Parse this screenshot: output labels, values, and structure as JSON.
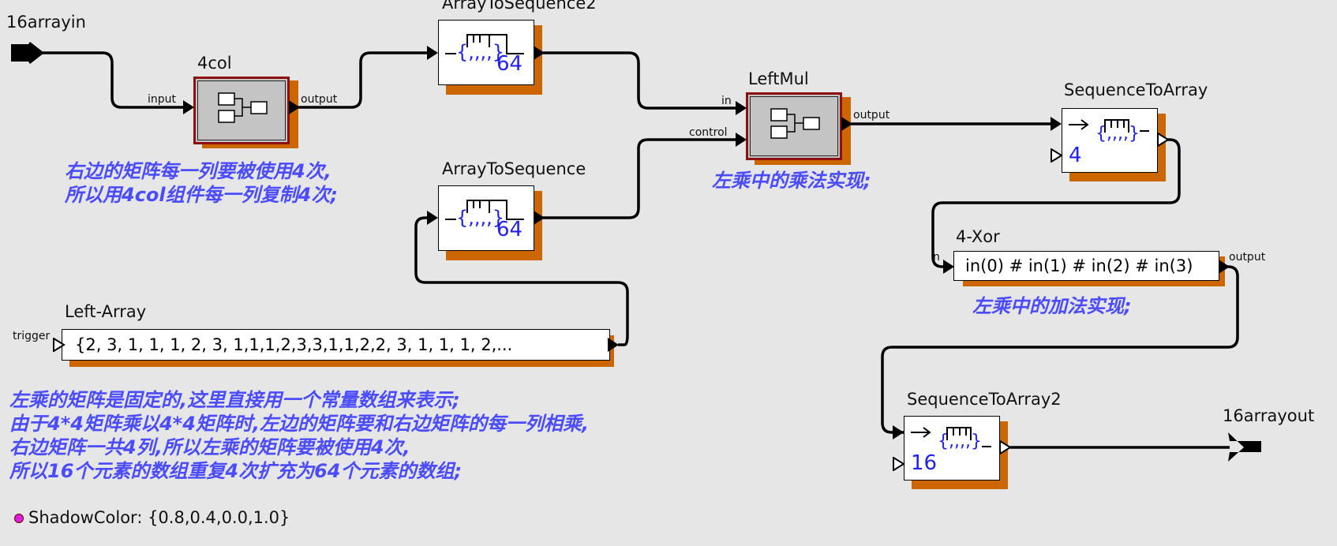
{
  "actors": {
    "input_port": "16arrayin",
    "output_port": "16arrayout",
    "col4": "4col",
    "ats2": "ArrayToSequence2",
    "ats": "ArrayToSequence",
    "leftmul": "LeftMul",
    "sta": "SequenceToArray",
    "xor": "4-Xor",
    "sta2": "SequenceToArray2",
    "left_array": "Left-Array"
  },
  "ports": {
    "input": "input",
    "output": "output",
    "in": "in",
    "control": "control",
    "trigger": "trigger",
    "n": "n"
  },
  "values": {
    "ats2_len": "64",
    "ats_len": "64",
    "sta_len": "4",
    "sta2_len": "16",
    "xor_expr": "in(0) # in(1) # in(2) # in(3)",
    "left_array_value": "{2, 3, 1, 1, 1, 2, 3, 1,1,1,2,3,3,1,1,2,2, 3, 1, 1, 1, 2,..."
  },
  "comments": {
    "right_matrix": [
      "右边的矩阵每一列要被使用4次,",
      "所以用4col组件每一列复制4次;"
    ],
    "mul": "左乘中的乘法实现;",
    "add": "左乘中的加法实现;",
    "left_matrix": [
      "左乘的矩阵是固定的,这里直接用一个常量数组来表示;",
      "由于4*4矩阵乘以4*4矩阵时,左边的矩阵要和右边矩阵的每一列相乘,",
      "右边矩阵一共4列,所以左乘的矩阵要被使用4次,",
      "所以16个元素的数组重复4次扩充为64个元素的数组;"
    ]
  },
  "parameter": {
    "text": "ShadowColor: {0.8,0.4,0.0,1.0}"
  },
  "colors": {
    "background": "#e6e6e6",
    "shadow": "#cc6600",
    "comment": "#4b4bff",
    "composite_border": "#8b1010",
    "composite_fill": "#c4c4c4",
    "param_dot": "#e020e0"
  },
  "icons": [
    "port-arrow-icon",
    "composite-actor-icon",
    "array-sequence-icon",
    "output-port-icon"
  ]
}
